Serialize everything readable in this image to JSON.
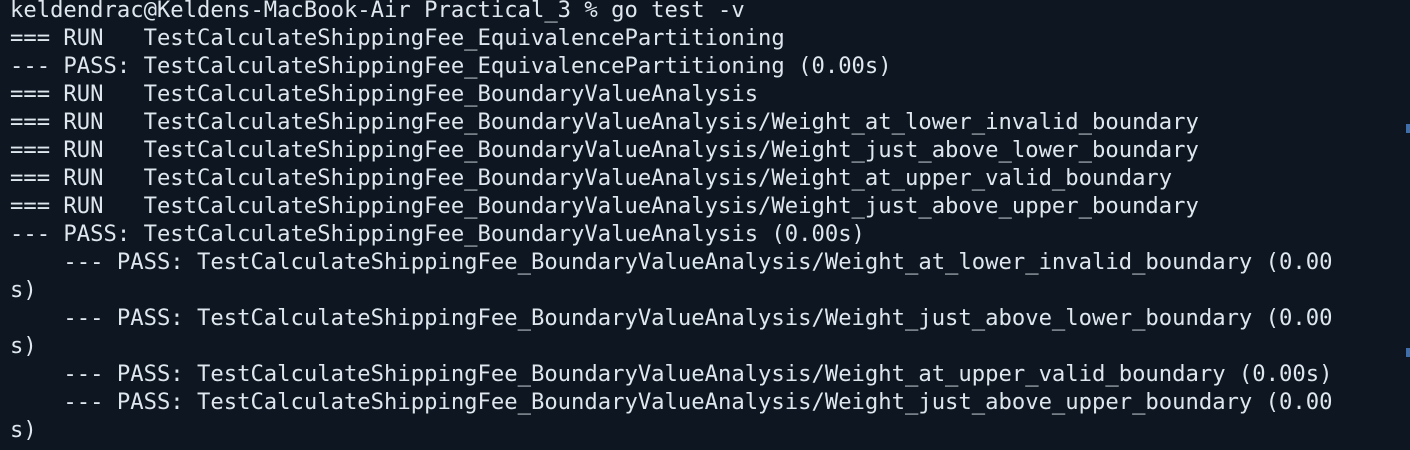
{
  "terminal": {
    "lines": [
      "keldendrac@Keldens-MacBook-Air Practical_3 % go test -v",
      "=== RUN   TestCalculateShippingFee_EquivalencePartitioning",
      "--- PASS: TestCalculateShippingFee_EquivalencePartitioning (0.00s)",
      "=== RUN   TestCalculateShippingFee_BoundaryValueAnalysis",
      "=== RUN   TestCalculateShippingFee_BoundaryValueAnalysis/Weight_at_lower_invalid_boundary",
      "=== RUN   TestCalculateShippingFee_BoundaryValueAnalysis/Weight_just_above_lower_boundary",
      "=== RUN   TestCalculateShippingFee_BoundaryValueAnalysis/Weight_at_upper_valid_boundary",
      "=== RUN   TestCalculateShippingFee_BoundaryValueAnalysis/Weight_just_above_upper_boundary",
      "--- PASS: TestCalculateShippingFee_BoundaryValueAnalysis (0.00s)",
      "    --- PASS: TestCalculateShippingFee_BoundaryValueAnalysis/Weight_at_lower_invalid_boundary (0.00",
      "s)",
      "    --- PASS: TestCalculateShippingFee_BoundaryValueAnalysis/Weight_just_above_lower_boundary (0.00",
      "s)",
      "    --- PASS: TestCalculateShippingFee_BoundaryValueAnalysis/Weight_at_upper_valid_boundary (0.00s)",
      "    --- PASS: TestCalculateShippingFee_BoundaryValueAnalysis/Weight_just_above_upper_boundary (0.00",
      "s)"
    ]
  },
  "colors": {
    "background": "#0e1621",
    "text": "#dfe6ee",
    "scroll_marker": "#3f6ea8"
  }
}
